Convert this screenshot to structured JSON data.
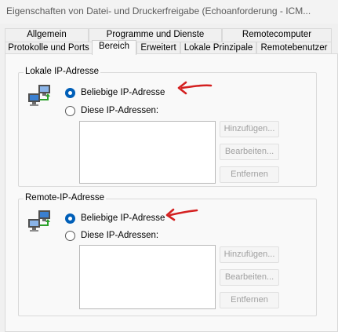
{
  "window": {
    "title": "Eigenschaften von Datei- und Druckerfreigabe (Echoanforderung - ICM..."
  },
  "tabs": {
    "row_back": [
      {
        "label": "Allgemein"
      },
      {
        "label": "Programme und Dienste"
      },
      {
        "label": "Remotecomputer"
      }
    ],
    "row_front": [
      {
        "label": "Protokolle und Ports"
      },
      {
        "label": "Bereich",
        "active": true
      },
      {
        "label": "Erweitert"
      },
      {
        "label": "Lokale Prinzipale"
      },
      {
        "label": "Remotebenutzer"
      }
    ]
  },
  "local_group": {
    "title": "Lokale IP-Adresse",
    "icon": "network-computers-icon",
    "option_any": "Beliebige IP-Adresse",
    "option_these": "Diese IP-Adressen:",
    "selected": "any",
    "add_button": "Hinzufügen...",
    "edit_button": "Bearbeiten...",
    "remove_button": "Entfernen"
  },
  "remote_group": {
    "title": "Remote-IP-Adresse",
    "icon": "network-computers-icon",
    "option_any": "Beliebige IP-Adresse",
    "option_these": "Diese IP-Adressen:",
    "selected": "any",
    "add_button": "Hinzufügen...",
    "edit_button": "Bearbeiten...",
    "remove_button": "Entfernen"
  },
  "annotations": {
    "arrow_color": "#d42020"
  },
  "colors": {
    "accent": "#005fb8",
    "disabled_text": "#a0a0a0"
  }
}
